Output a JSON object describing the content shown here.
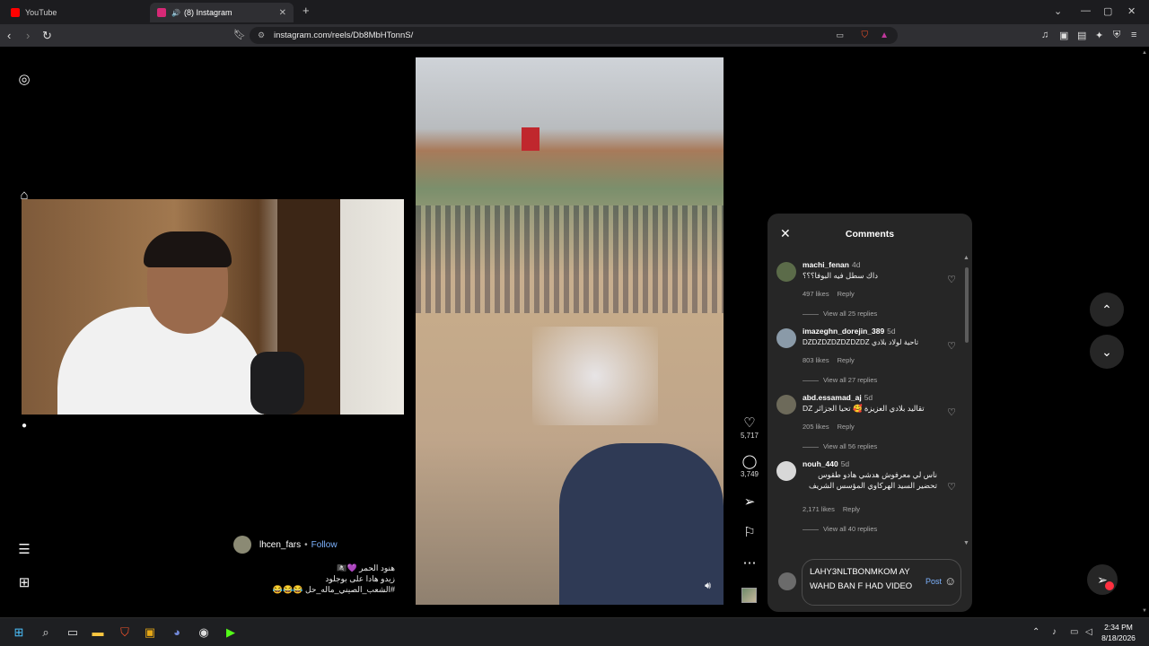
{
  "browser": {
    "tabs": [
      {
        "label": "YouTube",
        "icon": "youtube-icon",
        "color": "#ff0000"
      },
      {
        "label": "(8) Instagram",
        "icon": "instagram-icon",
        "color": "#d62976",
        "audio": "🔊"
      }
    ],
    "new_tab": "+",
    "url": "instagram.com/reels/Db8MbHTonnS/"
  },
  "instagram": {
    "sidebar_icons": [
      "instagram-logo-icon",
      "home-icon",
      "menu-icon",
      "more-apps-icon"
    ],
    "reel": {
      "author": "lhcen_fars",
      "separator": "•",
      "follow_label": "Follow",
      "caption_lines": [
        "هنود الحمر 💜🏴‍☠️",
        "زيدو هادا على بوجلود",
        "#الشعب_الصيني_ماله_حل 😂😂😂"
      ],
      "likes": "5,717",
      "comments": "3,749"
    },
    "comments_panel": {
      "title": "Comments",
      "items": [
        {
          "user": "machi_fenan",
          "age": "4d",
          "text": "داك سطل فيه البوفا؟؟؟",
          "likes": "497 likes",
          "reply": "Reply",
          "replies": "View all 25 replies",
          "avatar_color": "#5b6b49"
        },
        {
          "user": "imazeghn_dorejin_389",
          "age": "5d",
          "text": "تاحية لولاد بلادي DZDZDZDZDZDZDZ",
          "likes": "803 likes",
          "reply": "Reply",
          "replies": "View all 27 replies",
          "avatar_color": "#8a9aa8"
        },
        {
          "user": "abd.essamad_aj",
          "age": "5d",
          "text": "تقاليد بلادي العزيزة 🥰 تحيا الجزائر DZ",
          "likes": "205 likes",
          "reply": "Reply",
          "replies": "View all 56 replies",
          "avatar_color": "#6d6a5a"
        },
        {
          "user": "nouh_440",
          "age": "5d",
          "text": "ناس لي معرفوش هدشي هادو طقوس تحضير السيد الهركاوي المؤسس الشريف",
          "likes": "2,171 likes",
          "reply": "Reply",
          "replies": "View all 40 replies",
          "avatar_color": "#d8d8d8"
        }
      ],
      "input_value": "LAHY3NLTBONMKOM AY WAHD BAN F HAD VIDEO",
      "post_label": "Post"
    }
  },
  "taskbar": {
    "time": "2:34 PM",
    "date": "8/18/2026"
  }
}
